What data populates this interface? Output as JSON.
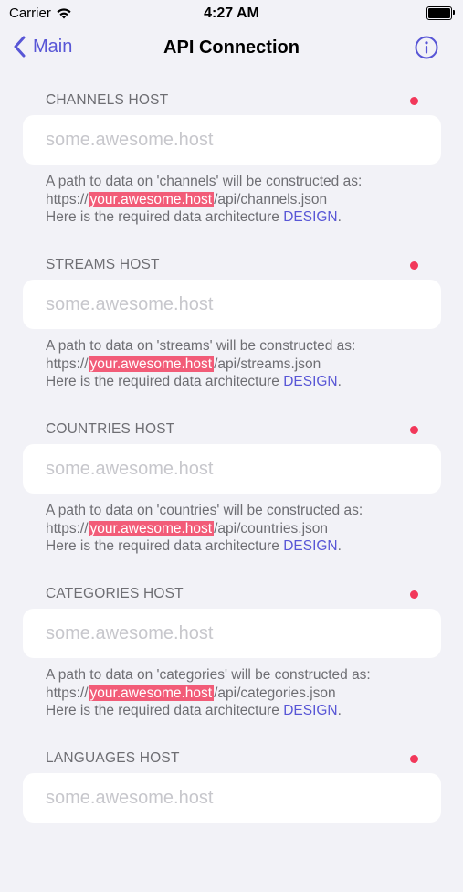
{
  "status_bar": {
    "carrier": "Carrier",
    "time": "4:27 AM"
  },
  "nav": {
    "back_label": "Main",
    "title": "API Connection"
  },
  "colors": {
    "accent": "#5856d6",
    "required_dot": "#f2385a",
    "highlight": "#f25c78",
    "background": "#f2f2f7"
  },
  "sections": [
    {
      "header": "CHANNELS HOST",
      "placeholder": "some.awesome.host",
      "value": "",
      "footer": {
        "line1": "A path to data on 'channels' will be constructed as:",
        "prefix": "https://",
        "highlight": "your.awesome.host",
        "suffix": "/api/channels.json",
        "line3_prefix": "Here is the required data architecture ",
        "link": "DESIGN",
        "line3_suffix": "."
      }
    },
    {
      "header": "STREAMS HOST",
      "placeholder": "some.awesome.host",
      "value": "",
      "footer": {
        "line1": "A path to data on 'streams' will be constructed as:",
        "prefix": "https://",
        "highlight": "your.awesome.host",
        "suffix": "/api/streams.json",
        "line3_prefix": "Here is the required data architecture ",
        "link": "DESIGN",
        "line3_suffix": "."
      }
    },
    {
      "header": "COUNTRIES HOST",
      "placeholder": "some.awesome.host",
      "value": "",
      "footer": {
        "line1": "A path to data on 'countries' will be constructed as:",
        "prefix": "https://",
        "highlight": "your.awesome.host",
        "suffix": "/api/countries.json",
        "line3_prefix": "Here is the required data architecture ",
        "link": "DESIGN",
        "line3_suffix": "."
      }
    },
    {
      "header": "CATEGORIES HOST",
      "placeholder": "some.awesome.host",
      "value": "",
      "footer": {
        "line1": "A path to data on 'categories' will be constructed as:",
        "prefix": "https://",
        "highlight": "your.awesome.host",
        "suffix": "/api/categories.json",
        "line3_prefix": "Here is the required data architecture ",
        "link": "DESIGN",
        "line3_suffix": "."
      }
    },
    {
      "header": "LANGUAGES HOST",
      "placeholder": "some.awesome.host",
      "value": ""
    }
  ]
}
